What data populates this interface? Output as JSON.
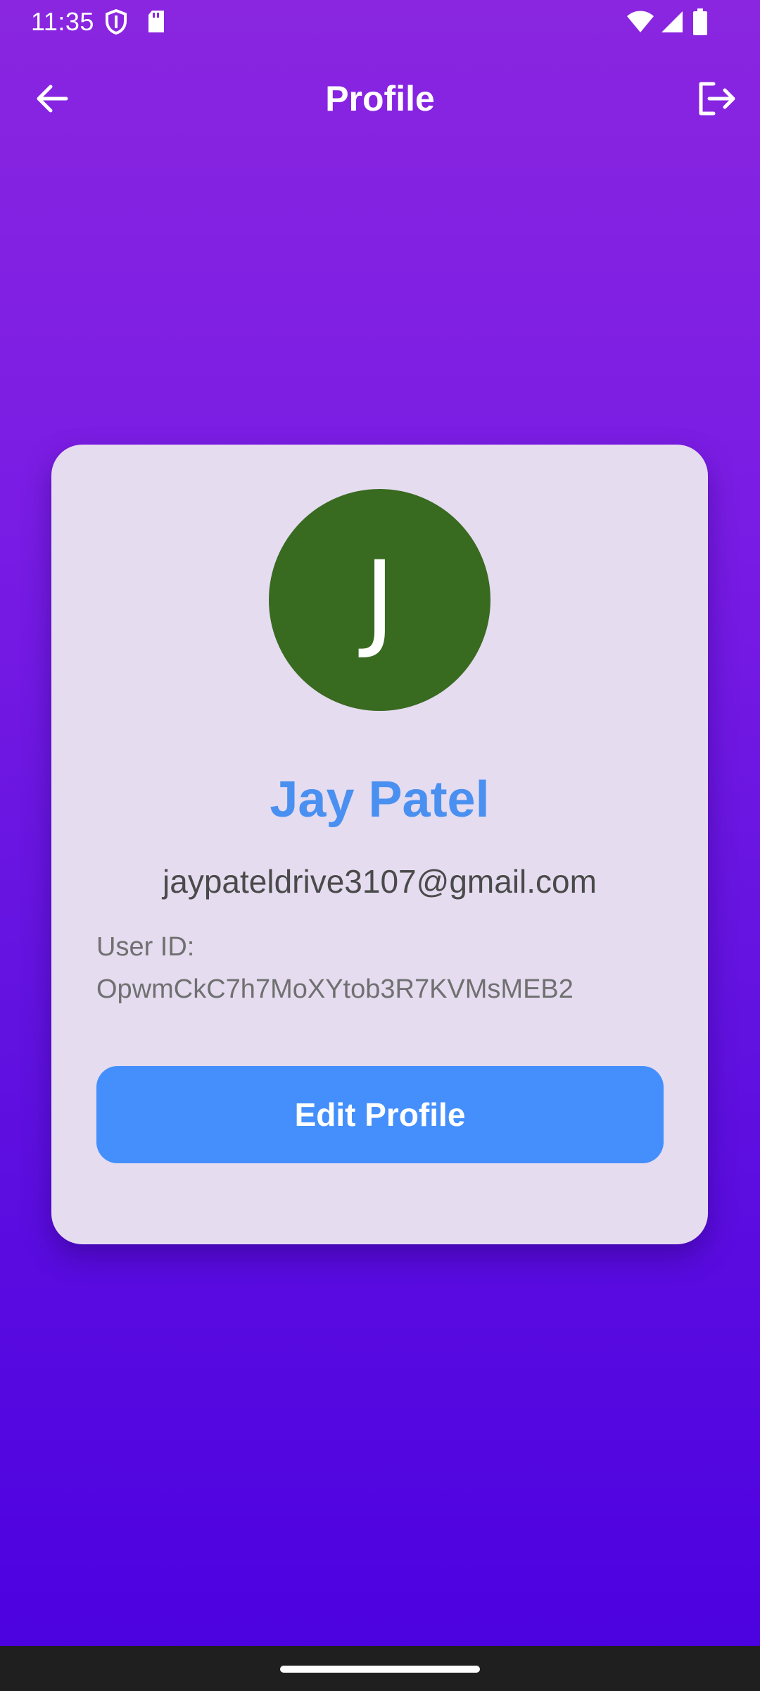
{
  "status_bar": {
    "time": "11:35",
    "icons": [
      "shield-icon",
      "sd-card-icon",
      "wifi-icon",
      "signal-icon",
      "battery-icon"
    ]
  },
  "app_bar": {
    "title": "Profile",
    "back_icon": "arrow-left-icon",
    "logout_icon": "logout-icon"
  },
  "profile": {
    "avatar_initial": "J",
    "avatar_color": "#386a20",
    "name": "Jay Patel",
    "email": "jaypateldrive3107@gmail.com",
    "user_id_label": "User ID:",
    "user_id_value": "OpwmCkC7h7MoXYtob3R7KVMsMEB2",
    "edit_button_label": "Edit Profile"
  },
  "colors": {
    "background_top": "#8a26e0",
    "background_bottom": "#4b00e0",
    "card": "#e5dcf0",
    "name": "#4a90f0",
    "button": "#448ffc"
  }
}
